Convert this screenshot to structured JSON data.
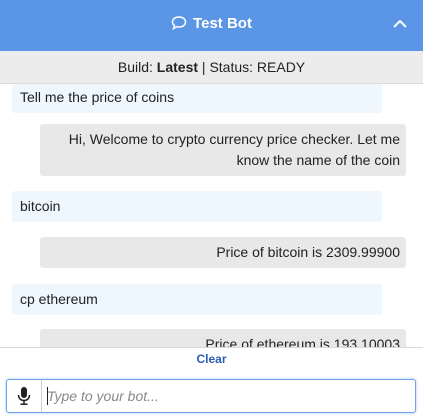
{
  "header": {
    "title": "Test Bot",
    "chat_icon": "chat-bubble-icon",
    "collapse_icon": "chevron-up-icon",
    "color": "#5b95e6"
  },
  "status": {
    "build_label": "Build:",
    "build_value": "Latest",
    "separator": "|",
    "status_text": "Status: READY"
  },
  "messages": [
    {
      "from": "user",
      "text": "Tell me the price of coins"
    },
    {
      "from": "bot",
      "text": "Hi, Welcome to crypto currency price checker. Let me know the name of the coin"
    },
    {
      "from": "user",
      "text": "bitcoin"
    },
    {
      "from": "bot",
      "text": "Price of bitcoin is 2309.99900"
    },
    {
      "from": "user",
      "text": "cp ethereum"
    },
    {
      "from": "bot",
      "text": "Price of ethereum is 193.10003"
    }
  ],
  "footer": {
    "clear_label": "Clear",
    "mic_icon": "microphone-icon",
    "input_placeholder": "Type to your bot...",
    "input_value": ""
  }
}
